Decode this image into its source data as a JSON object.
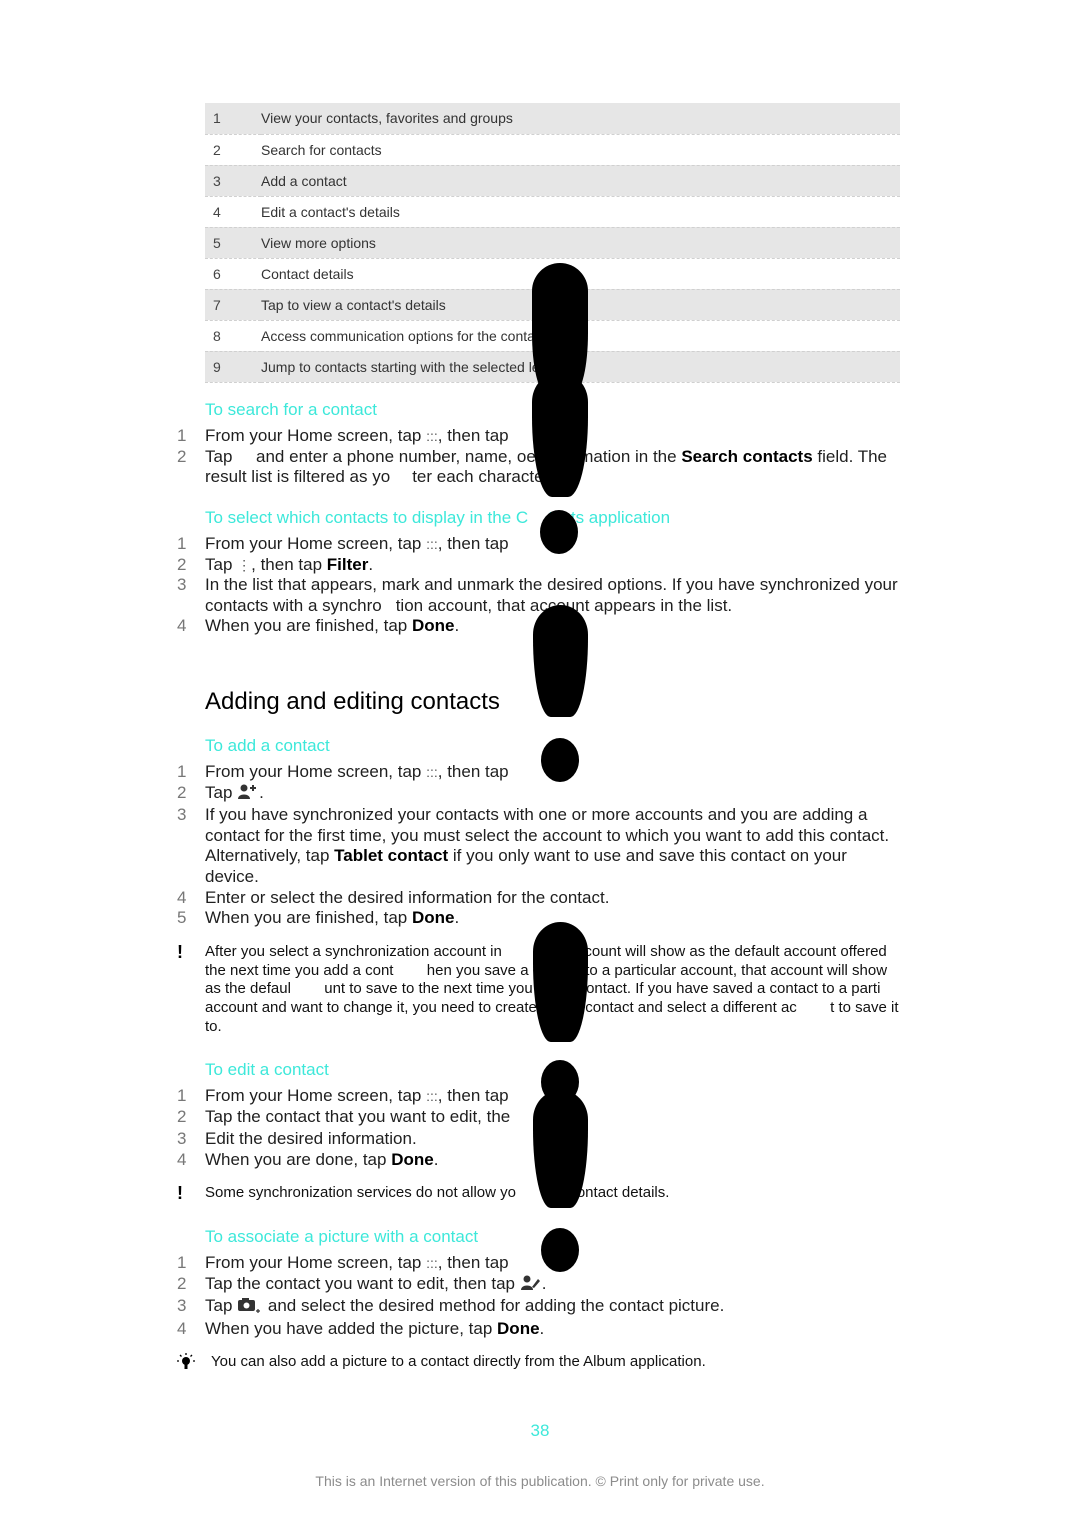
{
  "legend": [
    {
      "num": "1",
      "text": "View your contacts, favorites and groups"
    },
    {
      "num": "2",
      "text": "Search for contacts"
    },
    {
      "num": "3",
      "text": "Add a contact"
    },
    {
      "num": "4",
      "text": "Edit a contact's details"
    },
    {
      "num": "5",
      "text": "View more options"
    },
    {
      "num": "6",
      "text": "Contact details"
    },
    {
      "num": "7",
      "text": "Tap to view a contact's details"
    },
    {
      "num": "8",
      "text": "Access communication options for the contac"
    },
    {
      "num": "9",
      "text": "Jump to contacts starting with the selected let"
    }
  ],
  "search": {
    "heading": "To search for a contact",
    "steps": [
      {
        "num": "1",
        "a": "From your Home screen, tap ",
        "icon": ":::",
        "b": ", then tap"
      },
      {
        "num": "2",
        "a": "Tap     and enter a phone number, name, o",
        "gap": "",
        "b": "er information in the ",
        "bold": "Search contacts",
        "c": " field. The result list is filtered as yo",
        "d": "ter each character."
      }
    ]
  },
  "select": {
    "heading": "To select which contacts to display in the C",
    "heading_rest": "tacts application",
    "steps": [
      {
        "num": "1",
        "a": "From your Home screen, tap ",
        "icon": ":::",
        "b": ", then tap"
      },
      {
        "num": "2",
        "a": "Tap ",
        "icon": "⋮",
        "b": ", then tap ",
        "bold": "Filter",
        "c": "."
      },
      {
        "num": "3",
        "a": "In the list that appears, mark and unmark the desired options. If you have synchronized your contacts with a synchro",
        "b": "tion account, that account appears in the list."
      },
      {
        "num": "4",
        "a": "When you are finished, tap ",
        "bold": "Done",
        "c": "."
      }
    ]
  },
  "section_title": "Adding and editing contacts",
  "add": {
    "heading": "To add a contact",
    "steps": [
      {
        "num": "1",
        "a": "From your Home screen, tap ",
        "icon": ":::",
        "b": ", then tap"
      },
      {
        "num": "2",
        "a": "Tap ",
        "b": "."
      },
      {
        "num": "3",
        "a": "If you have synchronized your contacts with one or more accounts and you are adding a contact for the first time, you must select the account to which you want to add this contact. Alternatively, tap ",
        "bold": "Tablet contact",
        "c": " if you only want to use and save this contact on your device."
      },
      {
        "num": "4",
        "a": "Enter or select the desired information for the contact."
      },
      {
        "num": "5",
        "a": "When you are finished, tap ",
        "bold": "Done",
        "c": "."
      }
    ],
    "note_icon": "!",
    "note": "After you select a synchronization account in         that account will show as the default account offered the next time you add a cont        hen you save a contact to a particular account, that account will show as the defaul        unt to save to the next time you add a contact. If you have saved a contact to a parti        account and want to change it, you need to create a new contact and select a different ac        t to save it to."
  },
  "edit": {
    "heading": "To edit a contact",
    "steps": [
      {
        "num": "1",
        "a": "From your Home screen, tap ",
        "icon": ":::",
        "b": ", then tap"
      },
      {
        "num": "2",
        "a": "Tap the contact that you want to edit, the",
        "b": "."
      },
      {
        "num": "3",
        "a": "Edit the desired information."
      },
      {
        "num": "4",
        "a": "When you are done, tap ",
        "bold": "Done",
        "c": "."
      }
    ],
    "note_icon": "!",
    "note": "Some synchronization services do not allow yo      edit contact details."
  },
  "picture": {
    "heading": "To associate a picture with a contact",
    "steps": [
      {
        "num": "1",
        "a": "From your Home screen, tap ",
        "icon": ":::",
        "b": ", then tap"
      },
      {
        "num": "2",
        "a": "Tap the contact you want to edit, then tap ",
        "b": "."
      },
      {
        "num": "3",
        "a": "Tap ",
        "b": " and select the desired method for adding the contact picture."
      },
      {
        "num": "4",
        "a": "When you have added the picture, tap ",
        "bold": "Done",
        "c": "."
      }
    ],
    "tip_icon": "lightbulb",
    "tip": "You can also add a picture to a contact directly from the Album application."
  },
  "page_number": "38",
  "footer": "This is an Internet version of this publication. © Print only for private use.",
  "colors": {
    "accent": "#3de8da",
    "row_shade": "#e6e6e6",
    "footer": "#8c8c8c"
  }
}
